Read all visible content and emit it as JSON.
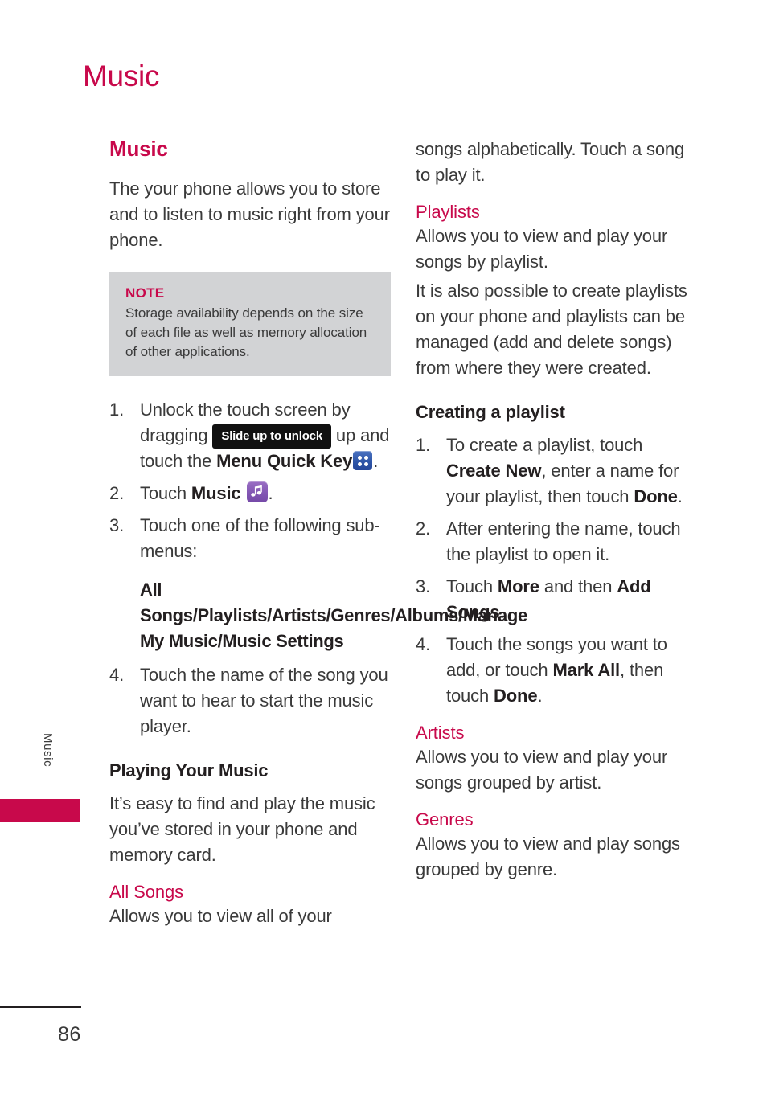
{
  "page": {
    "running_head": "Music",
    "page_number": "86",
    "side_tab_label": "Music",
    "accent_color": "#C8094B",
    "note_bg_color": "#d2d3d5"
  },
  "left_column": {
    "section_heading": "Music",
    "intro": "The your phone allows you to store and to listen to music right from your phone.",
    "note": {
      "title": "NOTE",
      "text": "Storage availability depends on the size of each file as well as memory allocation of other applications."
    },
    "steps": [
      {
        "num": "1.",
        "parts": [
          {
            "type": "text",
            "value": "Unlock the touch screen by dragging "
          },
          {
            "type": "badge",
            "value": "Slide up to unlock"
          },
          {
            "type": "text",
            "value": " up and touch the "
          },
          {
            "type": "bold",
            "value": "Menu Quick Key"
          },
          {
            "type": "icon",
            "value": "menu-quick-key-icon"
          },
          {
            "type": "text",
            "value": "."
          }
        ]
      },
      {
        "num": "2.",
        "parts": [
          {
            "type": "text",
            "value": "Touch "
          },
          {
            "type": "bold",
            "value": "Music"
          },
          {
            "type": "icon",
            "value": "music-app-icon"
          },
          {
            "type": "text",
            "value": "."
          }
        ]
      },
      {
        "num": "3.",
        "parts": [
          {
            "type": "text",
            "value": "Touch one of the following sub-menus:"
          }
        ]
      },
      {
        "num": "4.",
        "parts": [
          {
            "type": "text",
            "value": "Touch the name of the song you want to hear to start the music player."
          }
        ]
      }
    ],
    "submenus": "All Songs/Playlists/Artists/Genres/Albums/Manage My Music/Music Settings",
    "playing_heading": "Playing Your Music",
    "playing_body": "It’s easy to find and play the music you’ve stored in your phone and memory card.",
    "all_songs_heading": "All Songs",
    "all_songs_body": "Allows you to view all of your"
  },
  "right_column": {
    "continued_body": "songs alphabetically. Touch a song to play it.",
    "playlists_heading": "Playlists",
    "playlists_body_1": "Allows you to view and play your songs by playlist.",
    "playlists_body_2": "It is also possible to create playlists on your phone and playlists can be managed (add and delete songs) from where they were created.",
    "creating_heading": "Creating a playlist",
    "creating_steps": [
      {
        "num": "1.",
        "parts": [
          {
            "type": "text",
            "value": "To create a playlist, touch "
          },
          {
            "type": "bold",
            "value": "Create New"
          },
          {
            "type": "text",
            "value": ", enter a name for your playlist, then touch "
          },
          {
            "type": "bold",
            "value": "Done"
          },
          {
            "type": "text",
            "value": "."
          }
        ]
      },
      {
        "num": "2.",
        "parts": [
          {
            "type": "text",
            "value": "After entering the name, touch the playlist to open it."
          }
        ]
      },
      {
        "num": "3.",
        "parts": [
          {
            "type": "text",
            "value": "Touch "
          },
          {
            "type": "bold",
            "value": "More"
          },
          {
            "type": "text",
            "value": " and then "
          },
          {
            "type": "bold",
            "value": "Add Songs"
          },
          {
            "type": "text",
            "value": "."
          }
        ]
      },
      {
        "num": "4.",
        "parts": [
          {
            "type": "text",
            "value": "Touch the songs you want to add, or touch "
          },
          {
            "type": "bold",
            "value": "Mark All"
          },
          {
            "type": "text",
            "value": ", then touch "
          },
          {
            "type": "bold",
            "value": "Done"
          },
          {
            "type": "text",
            "value": "."
          }
        ]
      }
    ],
    "artists_heading": "Artists",
    "artists_body": "Allows you to view and play your songs grouped by artist.",
    "genres_heading": "Genres",
    "genres_body": "Allows you to view and play songs grouped by genre."
  }
}
